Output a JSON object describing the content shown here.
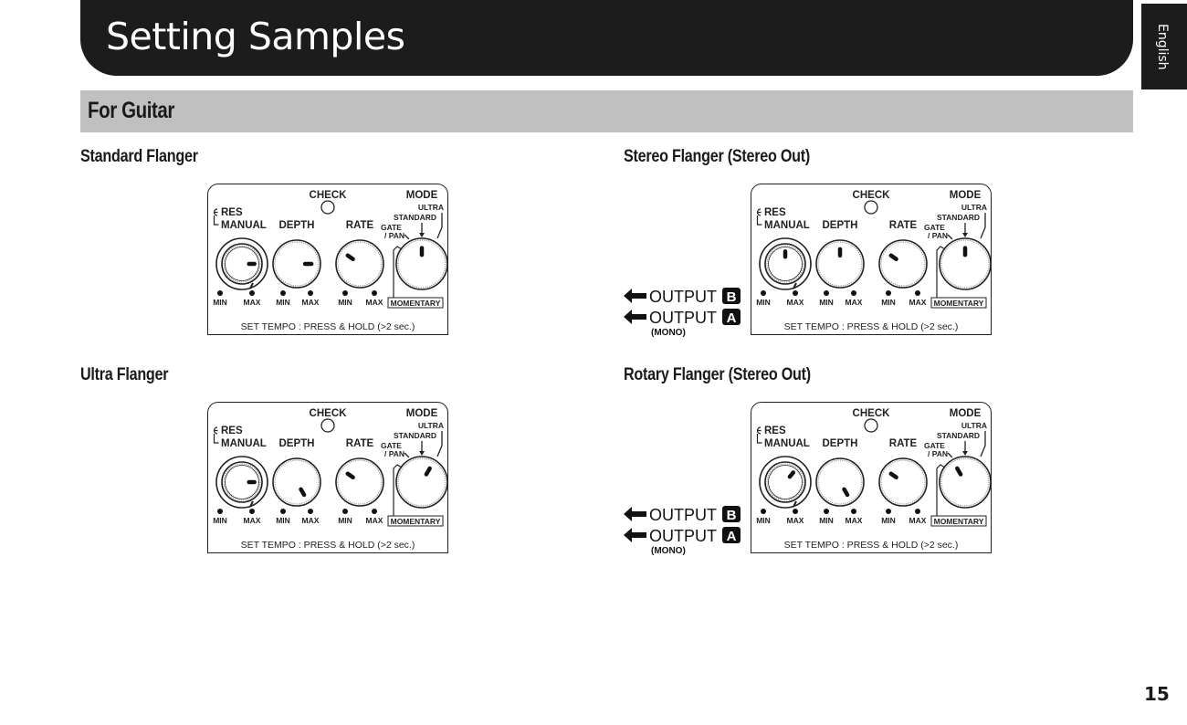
{
  "header": {
    "title": "Setting Samples",
    "language_tab": "English"
  },
  "section": {
    "title": "For Guitar"
  },
  "panel_labels": {
    "check": "CHECK",
    "mode": "MODE",
    "res": "RES",
    "manual": "MANUAL",
    "depth": "DEPTH",
    "rate": "RATE",
    "gate_pan_1": "GATE",
    "gate_pan_2": "/ PAN",
    "standard": "STANDARD",
    "ultra": "ULTRA",
    "min": "MIN",
    "max": "MAX",
    "momentary": "MOMENTARY",
    "set_tempo": "SET TEMPO : PRESS & HOLD (>2 sec.)"
  },
  "outputs": {
    "b_label": "OUTPUT",
    "b_badge": "B",
    "a_label": "OUTPUT",
    "a_badge": "A",
    "mono": "(MONO)"
  },
  "samples": [
    {
      "title": "Standard Flanger",
      "outputs": false,
      "knobs": {
        "manual_deg": 90,
        "depth_deg": 90,
        "rate_deg": -55,
        "mode_deg": 0
      },
      "mode": "STANDARD"
    },
    {
      "title": "Stereo Flanger (Stereo Out)",
      "outputs": true,
      "knobs": {
        "manual_deg": 0,
        "depth_deg": 0,
        "rate_deg": -55,
        "mode_deg": 0
      },
      "mode": "STANDARD"
    },
    {
      "title": "Ultra Flanger",
      "outputs": false,
      "knobs": {
        "manual_deg": 90,
        "depth_deg": 150,
        "rate_deg": -55,
        "mode_deg": 30
      },
      "mode": "ULTRA"
    },
    {
      "title": "Rotary Flanger (Stereo Out)",
      "outputs": true,
      "knobs": {
        "manual_deg": 40,
        "depth_deg": 150,
        "rate_deg": -55,
        "mode_deg": -30
      },
      "mode": "GATE / PAN"
    }
  ],
  "page_number": "15"
}
